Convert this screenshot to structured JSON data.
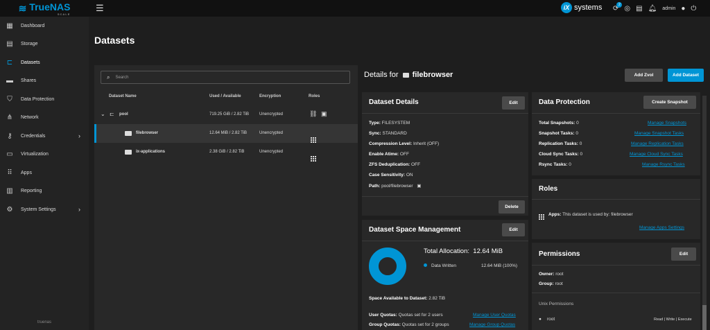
{
  "brand": {
    "name": "TrueNAS",
    "edition": "SCALE",
    "vendor": "systems",
    "vendor_mark": "iX"
  },
  "topbar": {
    "user": "admin",
    "notif_count": "2"
  },
  "sidebar": {
    "items": [
      {
        "label": "Dashboard"
      },
      {
        "label": "Storage"
      },
      {
        "label": "Datasets"
      },
      {
        "label": "Shares"
      },
      {
        "label": "Data Protection"
      },
      {
        "label": "Network"
      },
      {
        "label": "Credentials"
      },
      {
        "label": "Virtualization"
      },
      {
        "label": "Apps"
      },
      {
        "label": "Reporting"
      },
      {
        "label": "System Settings"
      }
    ],
    "hostname": "truenas"
  },
  "page": {
    "title": "Datasets"
  },
  "tree": {
    "search_placeholder": "Search",
    "columns": {
      "name": "Dataset Name",
      "used": "Used / Available",
      "encryption": "Encryption",
      "roles": "Roles"
    },
    "rows": [
      {
        "name": "pool",
        "used": "719.25 GiB / 2.82 TiB",
        "encryption": "Unencrypted"
      },
      {
        "name": "filebrowser",
        "used": "12.64 MiB / 2.82 TiB",
        "encryption": "Unencrypted"
      },
      {
        "name": "ix-applications",
        "used": "2.38 GiB / 2.82 TiB",
        "encryption": "Unencrypted"
      }
    ]
  },
  "details": {
    "title_prefix": "Details for",
    "dataset": "filebrowser",
    "add_zvol": "Add Zvol",
    "add_dataset": "Add Dataset"
  },
  "dataset_details": {
    "title": "Dataset Details",
    "edit": "Edit",
    "delete": "Delete",
    "type_k": "Type:",
    "type_v": "FILESYSTEM",
    "sync_k": "Sync:",
    "sync_v": "STANDARD",
    "comp_k": "Compression Level:",
    "comp_v": "Inherit (OFF)",
    "atime_k": "Enable Atime:",
    "atime_v": "OFF",
    "dedup_k": "ZFS Deduplication:",
    "dedup_v": "OFF",
    "case_k": "Case Sensitivity:",
    "case_v": "ON",
    "path_k": "Path:",
    "path_v": "pool/filebrowser"
  },
  "space": {
    "title": "Dataset Space Management",
    "edit": "Edit",
    "total_label": "Total Allocation:",
    "total_value": "12.64 MiB",
    "legend_label": "Data Written",
    "legend_value": "12.64 MiB (100%)",
    "available_k": "Space Available to Dataset:",
    "available_v": "2.82 TiB",
    "user_k": "User Quotas:",
    "user_v": "Quotas set for 2 users",
    "user_link": "Manage User Quotas",
    "group_k": "Group Quotas:",
    "group_v": "Quotas set for 2 groups",
    "group_link": "Manage Group Quotas",
    "chart_color": "#0095d5"
  },
  "protection": {
    "title": "Data Protection",
    "button": "Create Snapshot",
    "snap_k": "Total Snapshots:",
    "snap_v": "0",
    "snap_link": "Manage Snapshots",
    "stask_k": "Snapshot Tasks:",
    "stask_v": "0",
    "stask_link": "Manage Snapshot Tasks",
    "rep_k": "Replication Tasks:",
    "rep_v": "0",
    "rep_link": "Manage Replication Tasks",
    "cloud_k": "Cloud Sync Tasks:",
    "cloud_v": "0",
    "cloud_link": "Manage Cloud Sync Tasks",
    "rsync_k": "Rsync Tasks:",
    "rsync_v": "0",
    "rsync_link": "Manage Rsync Tasks"
  },
  "roles": {
    "title": "Roles",
    "apps_k": "Apps:",
    "apps_v": "This dataset is used by: filebrowser",
    "link": "Manage Apps Settings"
  },
  "permissions": {
    "title": "Permissions",
    "edit": "Edit",
    "owner_k": "Owner:",
    "owner_v": "root",
    "group_k": "Group:",
    "group_v": "root",
    "unix": "Unix Permissions",
    "entry": "root",
    "entry_perms": "Read | Write | Execute"
  }
}
